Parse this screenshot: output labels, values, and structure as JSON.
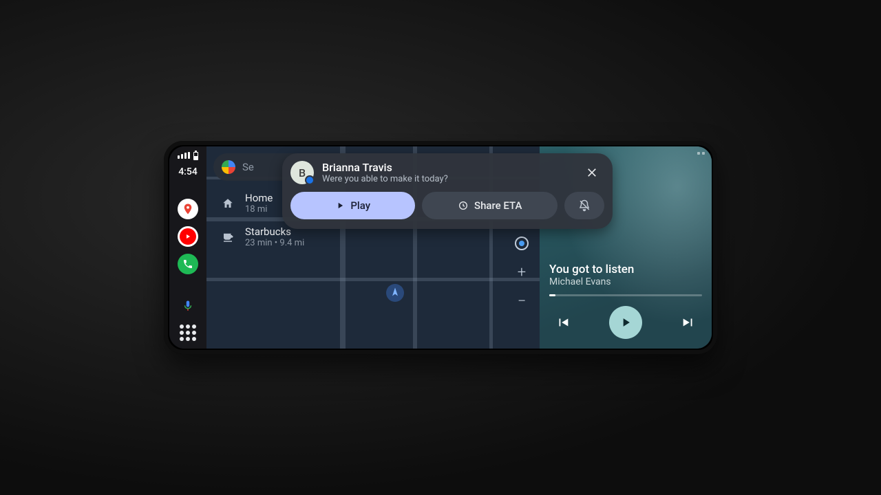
{
  "colors": {
    "accent_message": "#1a73e8",
    "play_pill": "#b7c4ff",
    "media_play": "#a5d6d5",
    "phone_green": "#1eb955"
  },
  "rail": {
    "time": "4:54",
    "apps": [
      "maps",
      "youtube-music",
      "phone"
    ],
    "mic_label": "assistant",
    "launcher_label": "app-grid"
  },
  "map": {
    "search_placeholder": "Se",
    "destinations": [
      {
        "title": "Home",
        "sub": "18 mi",
        "icon": "home-icon"
      },
      {
        "title": "Starbucks",
        "sub": "23 min • 9.4 mi",
        "icon": "cafe-icon"
      }
    ],
    "controls": {
      "recenter": "recenter",
      "zoom_in": "+",
      "zoom_out": "−"
    }
  },
  "notification": {
    "avatar_initial": "B",
    "name": "Brianna Travis",
    "message": "Were you able to make it today?",
    "play_label": "Play",
    "share_label": "Share ETA",
    "mute_label": "mute",
    "close_label": "close"
  },
  "media": {
    "track": "You got to listen",
    "artist": "Michael Evans",
    "prev": "previous",
    "play": "play",
    "next": "next"
  }
}
